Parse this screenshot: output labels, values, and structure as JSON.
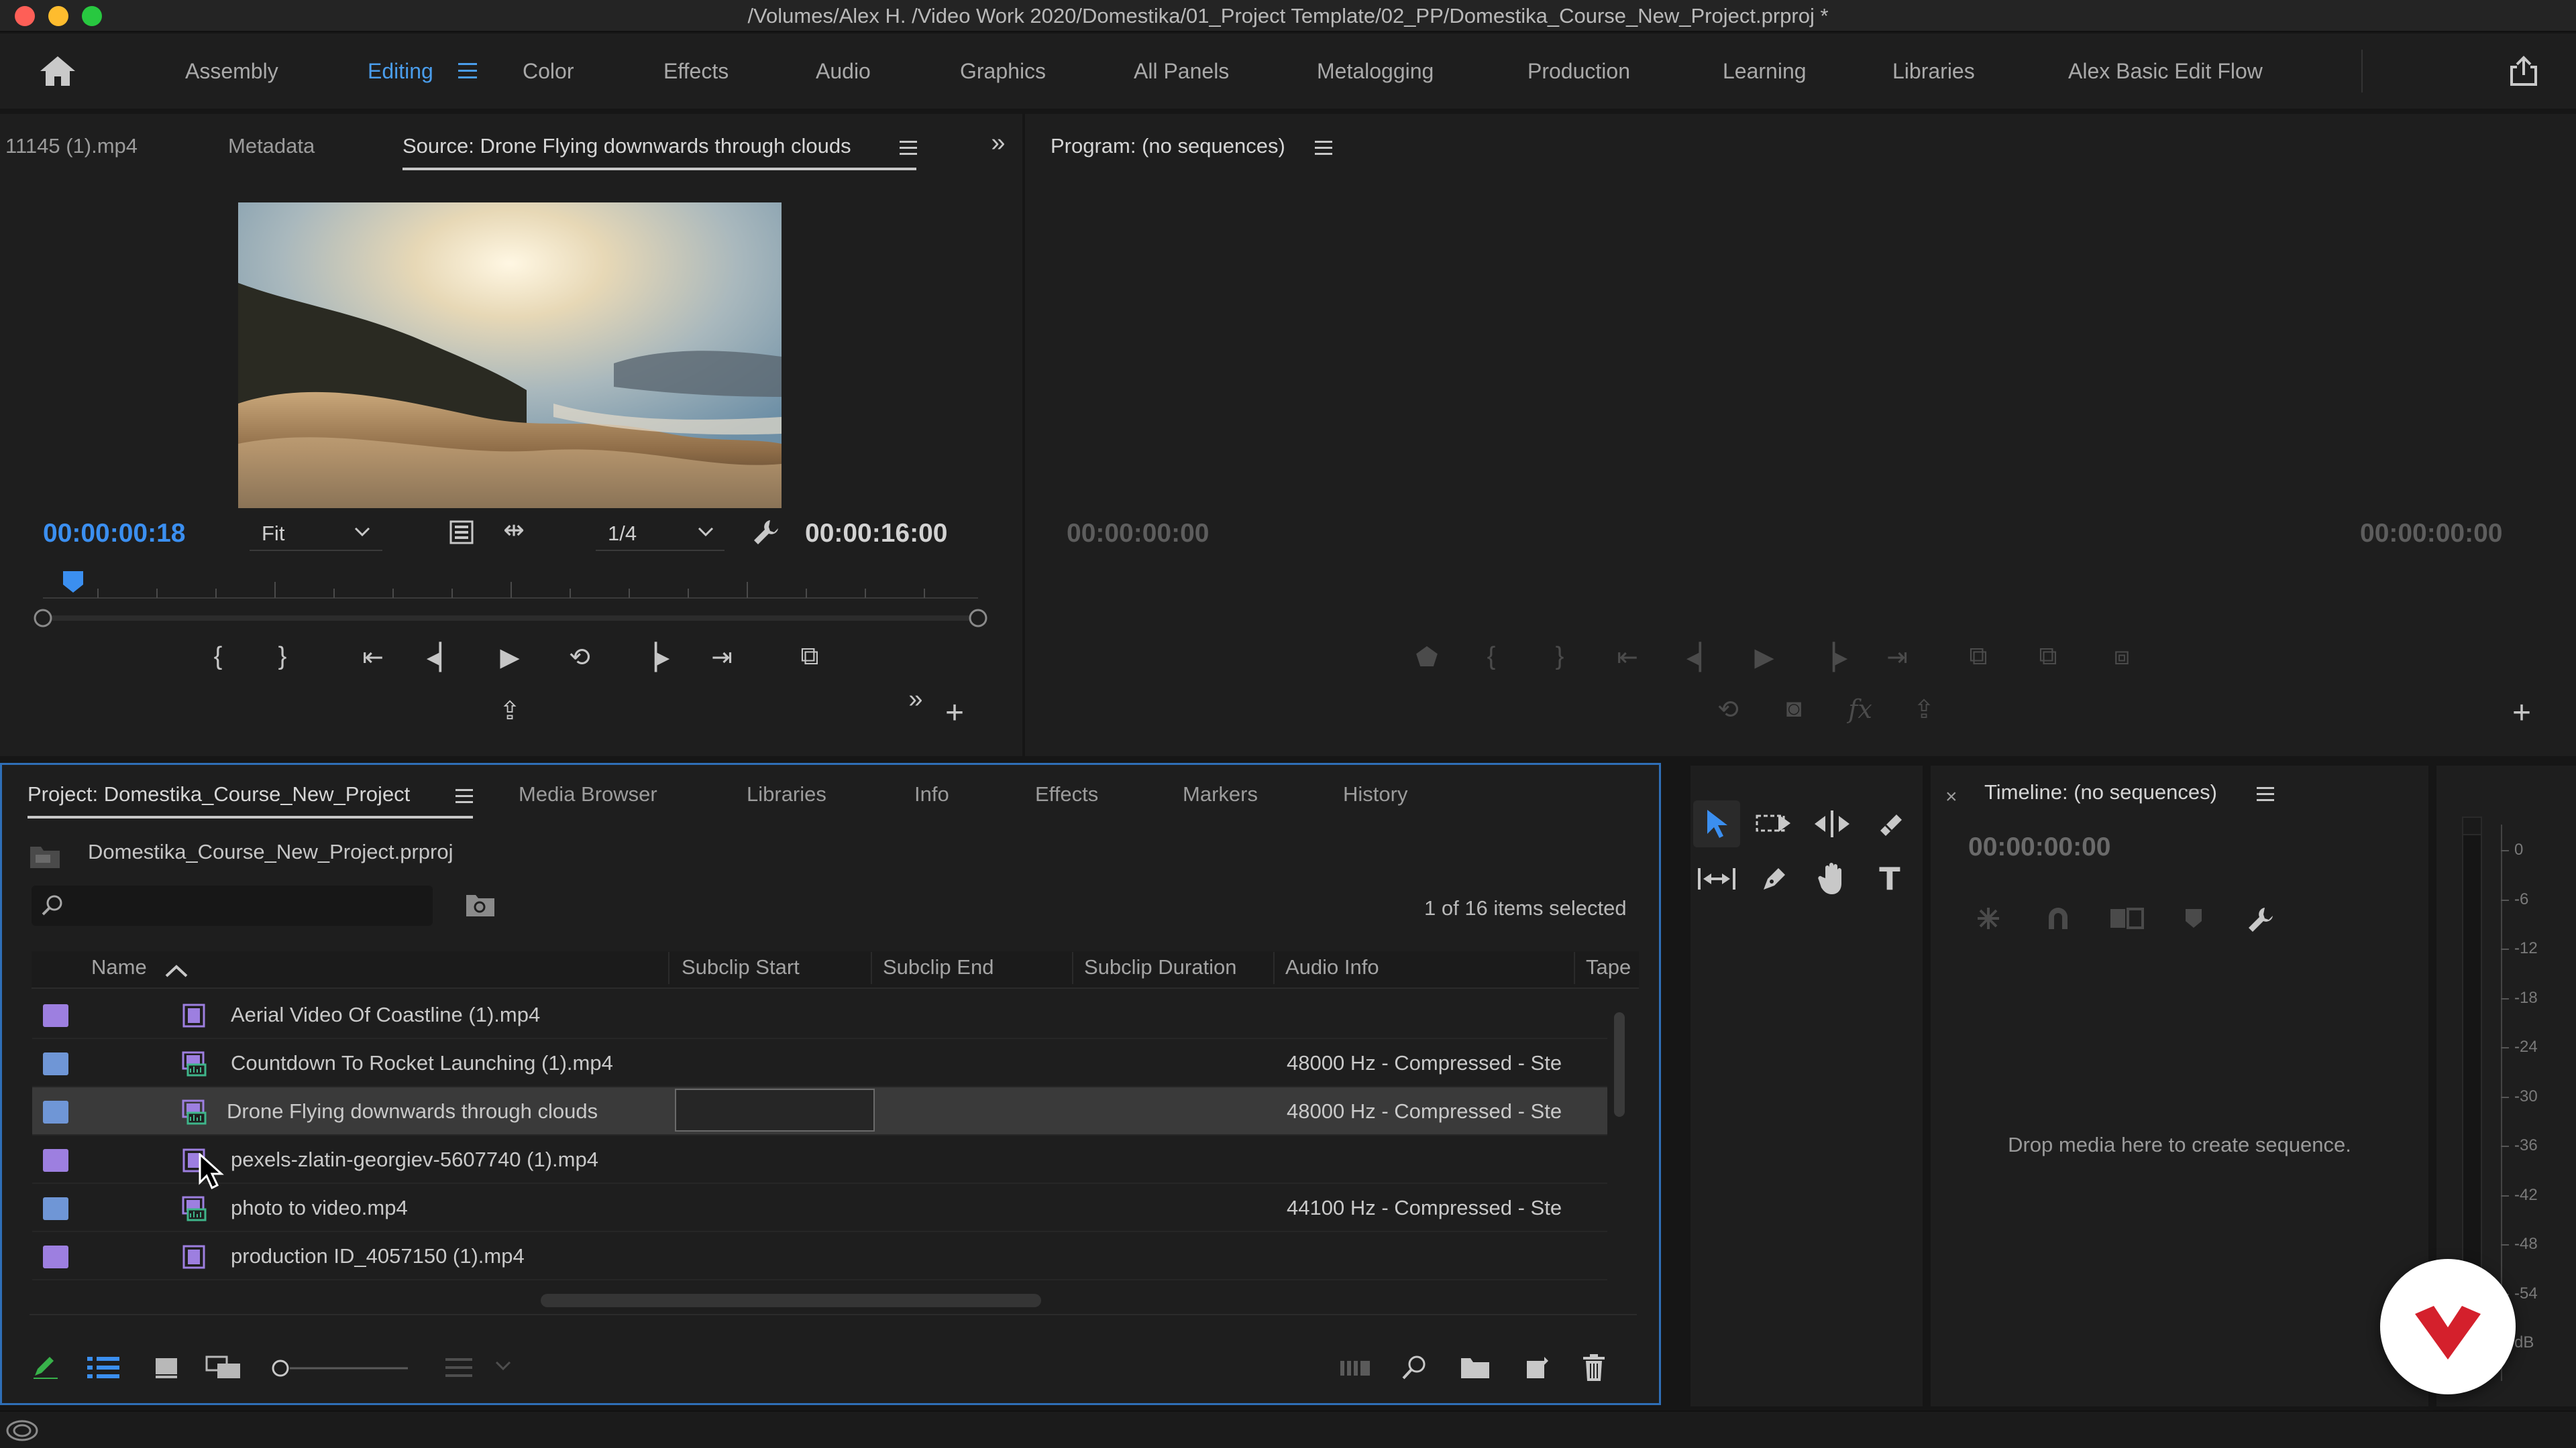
{
  "window": {
    "title": "/Volumes/Alex H. /Video Work 2020/Domestika/01_Project Template/02_PP/Domestika_Course_New_Project.prproj *"
  },
  "workspaces": {
    "items": [
      "Assembly",
      "Editing",
      "Color",
      "Effects",
      "Audio",
      "Graphics",
      "All Panels",
      "Metalogging",
      "Production",
      "Learning",
      "Libraries",
      "Alex Basic Edit Flow"
    ],
    "active": "Editing"
  },
  "source_monitor": {
    "tabs": [
      "11145 (1).mp4",
      "Metadata",
      "Source: Drone Flying downwards through clouds"
    ],
    "current_time": "00:00:00:18",
    "fit": "Fit",
    "resolution": "1/4",
    "duration": "00:00:16:00",
    "playhead_progress": 0.032
  },
  "program_monitor": {
    "title": "Program: (no sequences)",
    "time_left": "00:00:00:00",
    "time_right": "00:00:00:00"
  },
  "project_panel": {
    "tabs": [
      "Project: Domestika_Course_New_Project",
      "Media Browser",
      "Libraries",
      "Info",
      "Effects",
      "Markers",
      "History"
    ],
    "project_file": "Domestika_Course_New_Project.prproj",
    "search_placeholder": "",
    "selection_status": "1 of 16 items selected",
    "columns": [
      "Name",
      "Subclip Start",
      "Subclip End",
      "Subclip Duration",
      "Audio Info",
      "Tape"
    ],
    "rows": [
      {
        "name": "Aerial Video Of Coastline (1).mp4",
        "audio": "",
        "color": "#9d7fe0",
        "type": "video"
      },
      {
        "name": "Countdown To Rocket Launching (1).mp4",
        "audio": "48000 Hz - Compressed - Ste",
        "color": "#6f96d6",
        "type": "av"
      },
      {
        "name": "Drone Flying downwards through clouds",
        "audio": "48000 Hz - Compressed - Ste",
        "color": "#6f96d6",
        "type": "av"
      },
      {
        "name": "pexels-zlatin-georgiev-5607740 (1).mp4",
        "audio": "",
        "color": "#9d7fe0",
        "type": "video"
      },
      {
        "name": "photo to video.mp4",
        "audio": "44100 Hz - Compressed - Ste",
        "color": "#6f96d6",
        "type": "av"
      },
      {
        "name": "production ID_4057150 (1).mp4",
        "audio": "",
        "color": "#9d7fe0",
        "type": "video"
      }
    ]
  },
  "timeline": {
    "title": "Timeline: (no sequences)",
    "timecode": "00:00:00:00",
    "drop_hint": "Drop media here to create sequence."
  },
  "audio_meter": {
    "labels": [
      "0",
      "-6",
      "-12",
      "-18",
      "-24",
      "-30",
      "-36",
      "-42",
      "-48",
      "-54",
      "dB"
    ]
  },
  "colors": {
    "accent_blue": "#3b8ff0",
    "brand_red": "#d4202c"
  }
}
